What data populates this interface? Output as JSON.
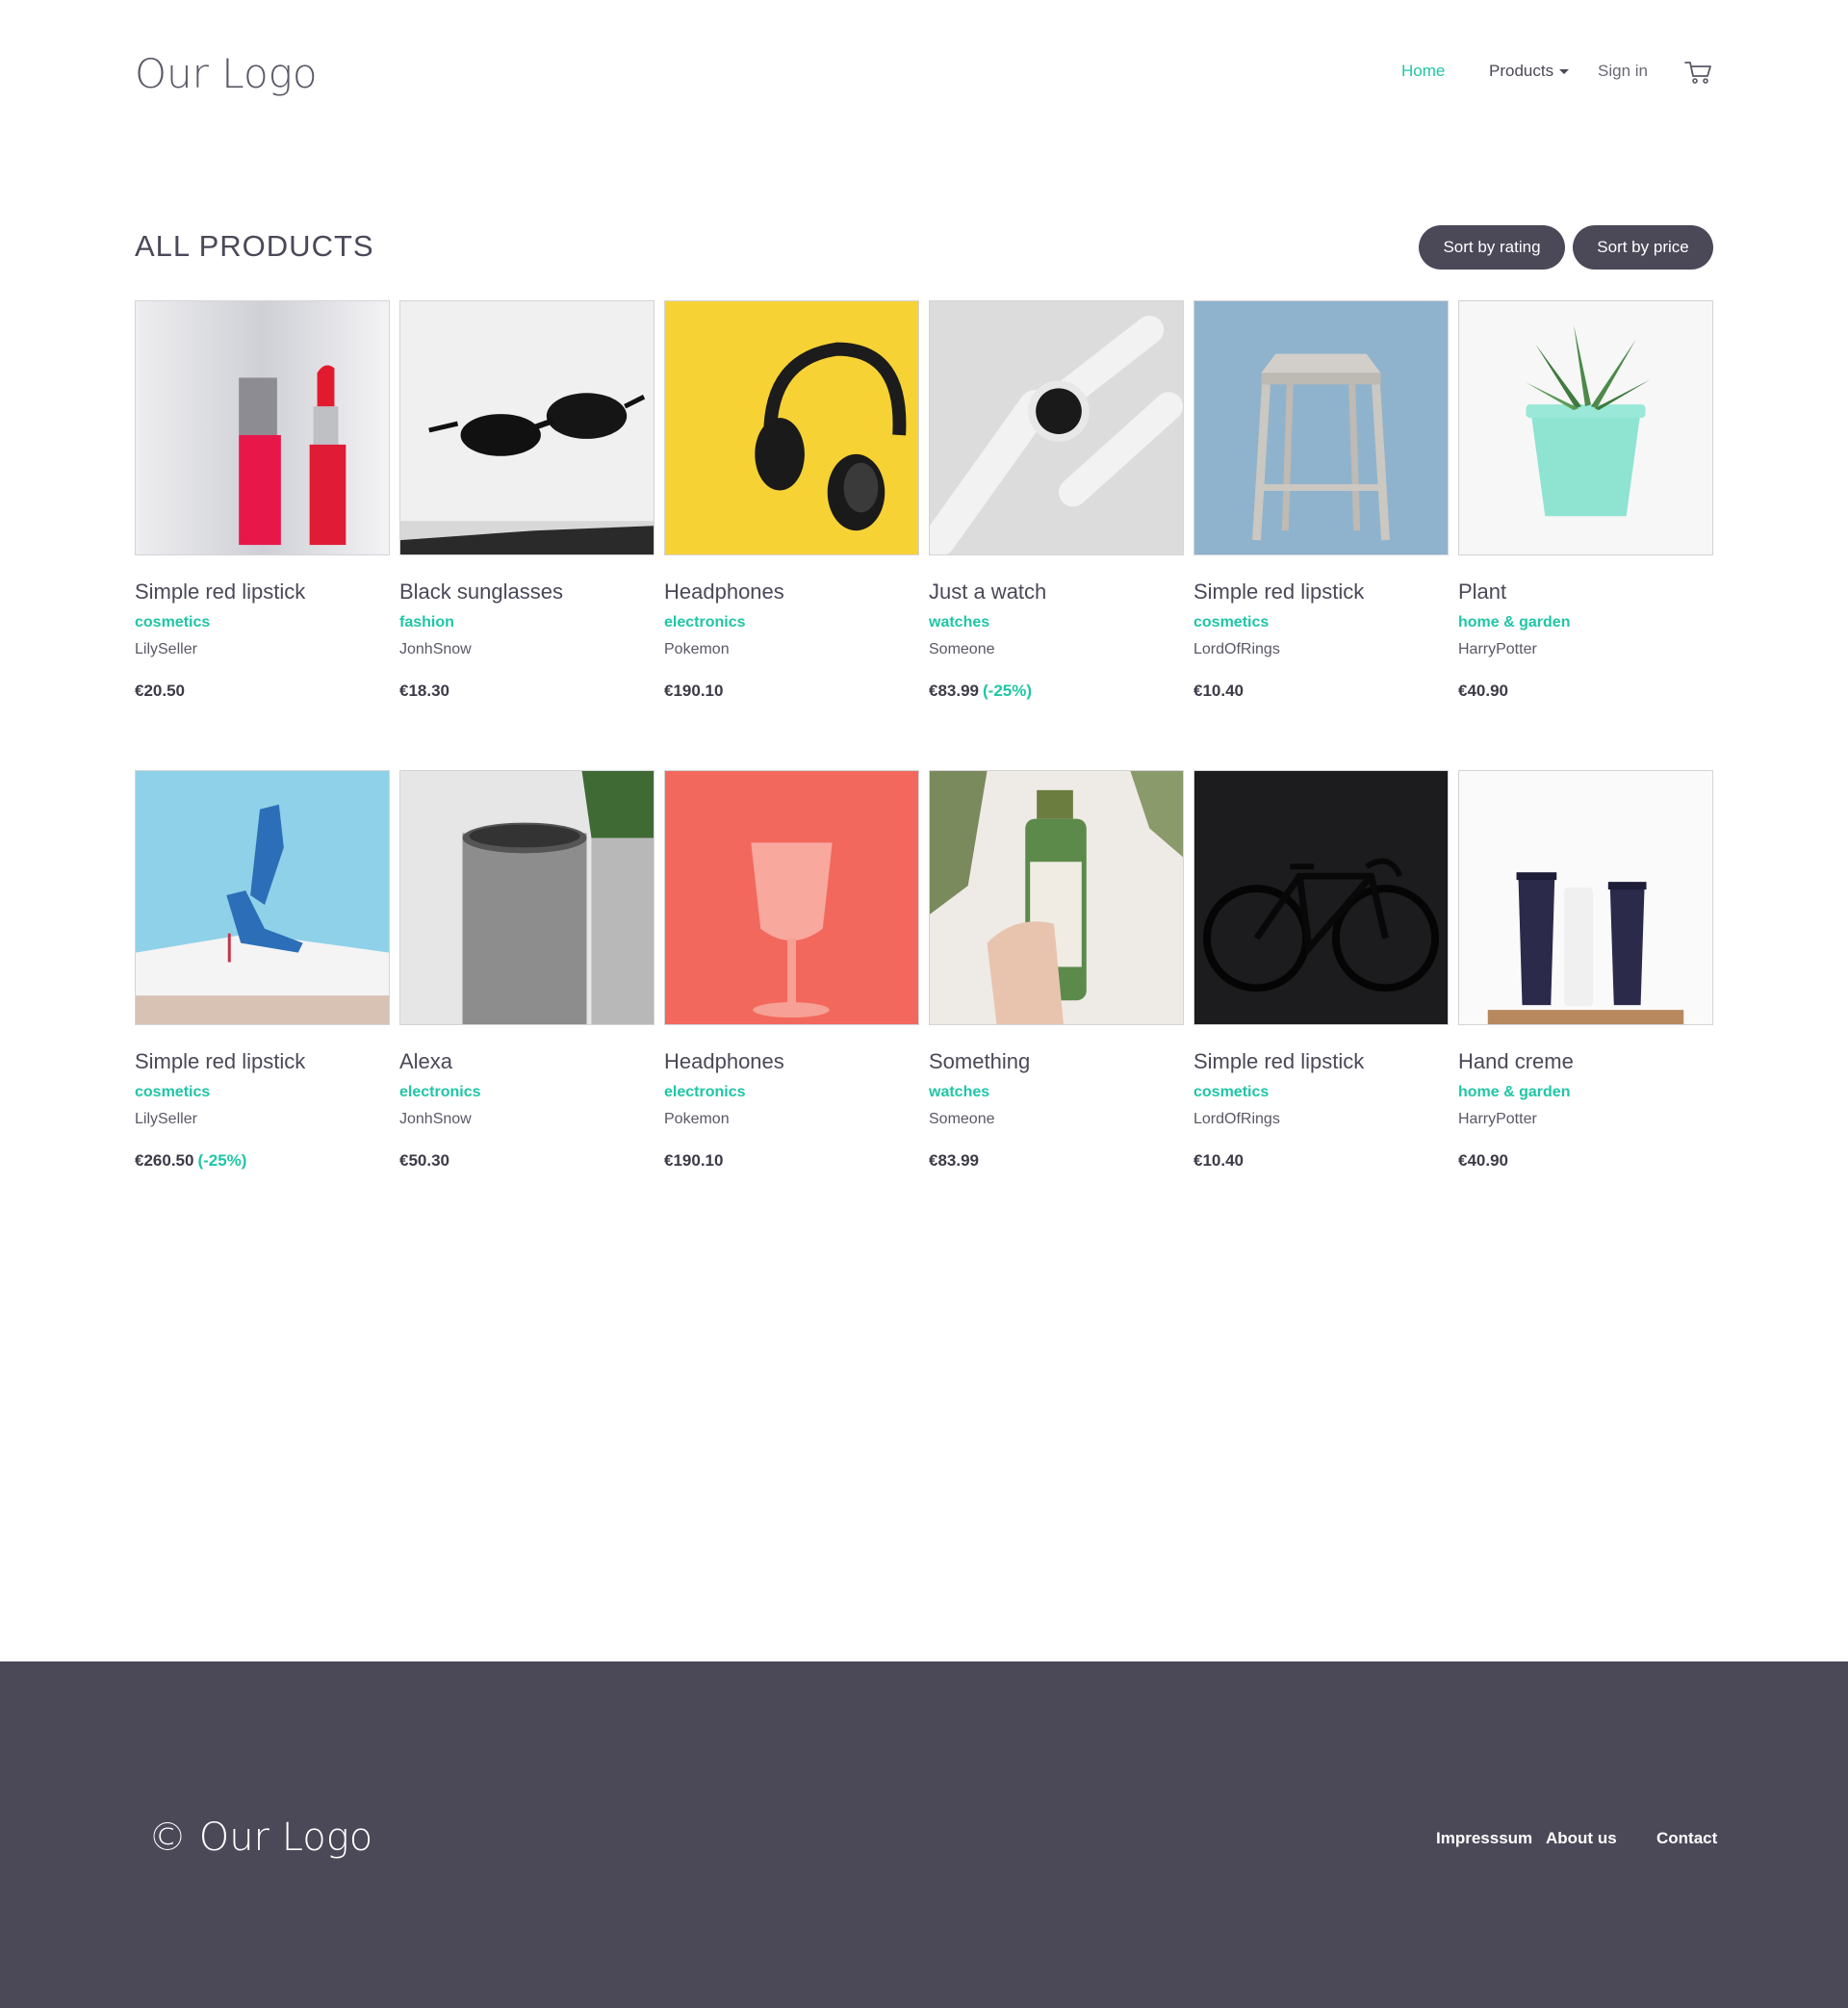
{
  "header": {
    "logo": "Our Logo",
    "nav": {
      "home": "Home",
      "products": "Products",
      "signin": "Sign in"
    }
  },
  "main": {
    "title": "ALL PRODUCTS",
    "sort_rating": "Sort by rating",
    "sort_price": "Sort by price"
  },
  "products": [
    {
      "name": "Simple red lipstick",
      "category": "cosmetics",
      "seller": "LilySeller",
      "price": "€20.50",
      "discount": ""
    },
    {
      "name": "Black sunglasses",
      "category": "fashion",
      "seller": "JonhSnow",
      "price": "€18.30",
      "discount": ""
    },
    {
      "name": "Headphones",
      "category": "electronics",
      "seller": "Pokemon",
      "price": "€190.10",
      "discount": ""
    },
    {
      "name": "Just a watch",
      "category": "watches",
      "seller": "Someone",
      "price": "€83.99",
      "discount": "(-25%)"
    },
    {
      "name": "Simple red lipstick",
      "category": "cosmetics",
      "seller": "LordOfRings",
      "price": "€10.40",
      "discount": ""
    },
    {
      "name": "Plant",
      "category": "home & garden",
      "seller": "HarryPotter",
      "price": "€40.90",
      "discount": ""
    },
    {
      "name": "Simple red lipstick",
      "category": "cosmetics",
      "seller": "LilySeller",
      "price": "€260.50",
      "discount": "(-25%)"
    },
    {
      "name": "Alexa",
      "category": "electronics",
      "seller": "JonhSnow",
      "price": "€50.30",
      "discount": ""
    },
    {
      "name": "Headphones",
      "category": "electronics",
      "seller": "Pokemon",
      "price": "€190.10",
      "discount": ""
    },
    {
      "name": "Something",
      "category": "watches",
      "seller": "Someone",
      "price": "€83.99",
      "discount": ""
    },
    {
      "name": "Simple red lipstick",
      "category": "cosmetics",
      "seller": "LordOfRings",
      "price": "€10.40",
      "discount": ""
    },
    {
      "name": "Hand creme",
      "category": "home & garden",
      "seller": "HarryPotter",
      "price": "€40.90",
      "discount": ""
    }
  ],
  "footer": {
    "logo": "© Our Logo",
    "links": {
      "impressum": "Impresssum",
      "about": "About us",
      "contact": "Contact"
    }
  },
  "colors": {
    "accent": "#1fc6a6",
    "dark": "#4b4858",
    "text": "#4b4858"
  }
}
